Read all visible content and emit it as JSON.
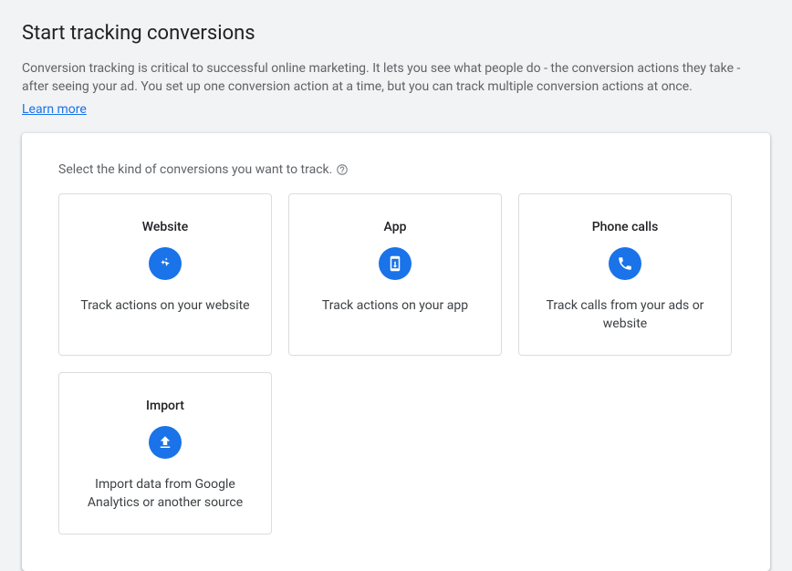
{
  "header": {
    "title": "Start tracking conversions",
    "description": "Conversion tracking is critical to successful online marketing. It lets you see what people do - the conversion actions they take - after seeing your ad. You set up one conversion action at a time, but you can track multiple conversion actions at once.",
    "learn_more": "Learn more"
  },
  "panel": {
    "select_label": "Select the kind of conversions you want to track.",
    "options": [
      {
        "title": "Website",
        "description": "Track actions on your website"
      },
      {
        "title": "App",
        "description": "Track actions on your app"
      },
      {
        "title": "Phone calls",
        "description": "Track calls from your ads or website"
      },
      {
        "title": "Import",
        "description": "Import data from Google Analytics or another source"
      }
    ]
  }
}
